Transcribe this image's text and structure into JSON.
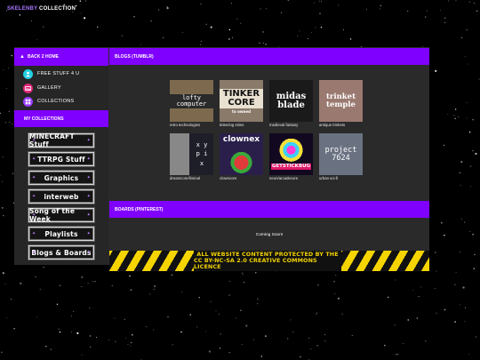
{
  "site": {
    "title_a": "SKELENBY",
    "title_b": " COLLECTION"
  },
  "sidebar": {
    "back_label": "BACK 2 HOME",
    "links": [
      {
        "label": "FREE STUFF 4 U",
        "icon": "person-icon",
        "color": "#22cfe0"
      },
      {
        "label": "GALLERY",
        "icon": "image-icon",
        "color": "#e0257a"
      },
      {
        "label": "COLLECTIONS",
        "icon": "collection-icon",
        "color": "#9a3bff"
      }
    ],
    "collections_label": "MY COLLECTIONS",
    "collections": [
      {
        "label": "MINECRAFT Stuff"
      },
      {
        "label": "TTRPG Stuff"
      },
      {
        "label": "Graphics"
      },
      {
        "label": "interweb"
      },
      {
        "label": "Song of the Week"
      },
      {
        "label": "Playlists"
      },
      {
        "label": "Blogs & Boards"
      }
    ]
  },
  "main": {
    "blogs_header": "BLOGS (TUMBLR)",
    "blogs": [
      {
        "caption": "retro technologies",
        "thumb_text": "lofty computer",
        "bg": "#7d6a4e",
        "fg": "#ffffff"
      },
      {
        "caption": "tinkering stims",
        "thumb_text": "TINKER CORE",
        "sub": "to owned",
        "bg": "#8a7a6a",
        "fg": "#111111"
      },
      {
        "caption": "medieval fantasy",
        "thumb_text": "midas blade",
        "bg": "#1a1a1a",
        "fg": "#ffffff"
      },
      {
        "caption": "antique trinkets",
        "thumb_text": "trinket temple",
        "bg": "#9a7a70",
        "fg": "#ffffff"
      },
      {
        "caption": "dreamcore/liminal",
        "thumb_text": "x y p i x",
        "bg": "#1e1e28",
        "fg": "#ffffff"
      },
      {
        "caption": "clowncore",
        "thumb_text": "clownex",
        "bg": "#2a1f4a",
        "fg": "#ffffff"
      },
      {
        "caption": "neon/arcadecore",
        "thumb_text": "GETSTICKBUG",
        "bg": "#120820",
        "fg": "#ffffff"
      },
      {
        "caption": "urban sci-fi",
        "thumb_text": "project 7624",
        "bg": "#6a7282",
        "fg": "#ffffff"
      }
    ],
    "boards_header": "BOARDS (PINTEREST)",
    "boards_status": "Coming Soon!"
  },
  "licence": {
    "line1": "ALL WEBSITE CONTENT PROTECTED BY THE",
    "line2": "CC BY-NC-SA 2.0 CREATIVE COMMONS  LICENCE"
  }
}
